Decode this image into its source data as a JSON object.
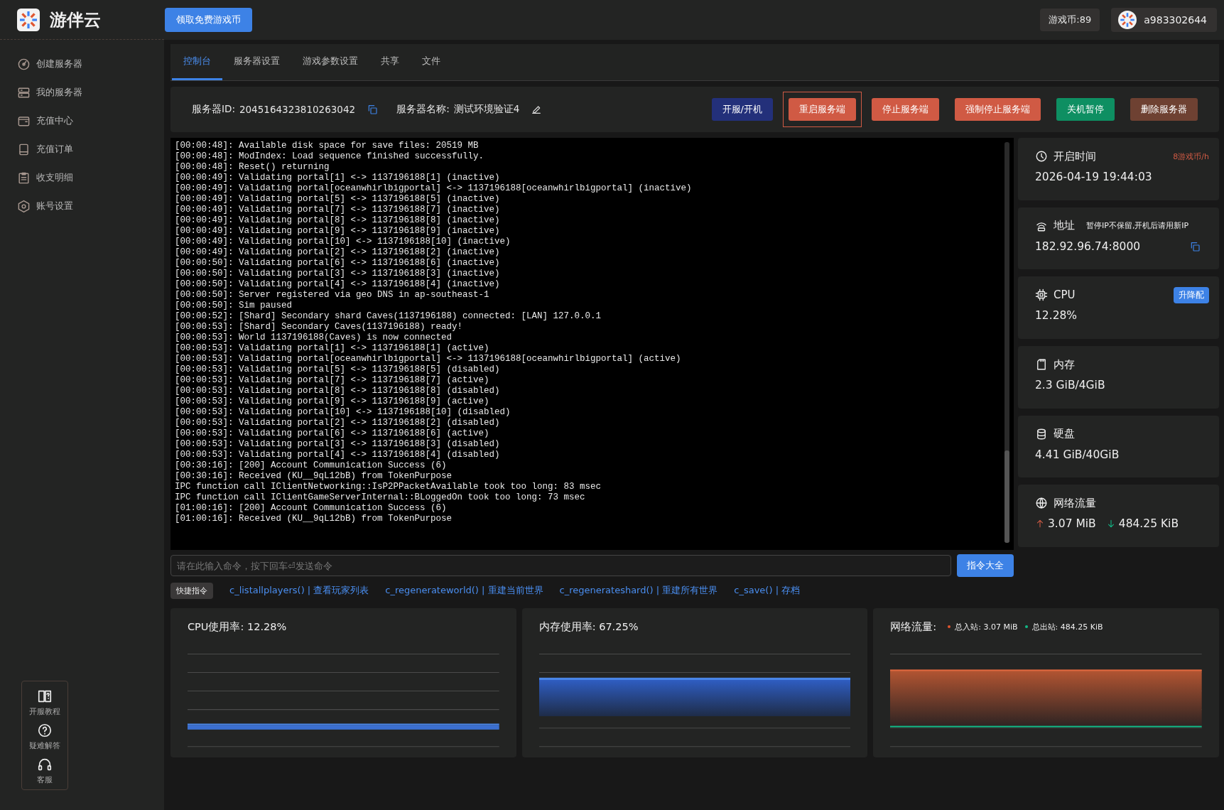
{
  "app": {
    "name": "游伴云",
    "promo_button": "领取免费游戏币",
    "coins": "游戏币:89",
    "user": "a983302644"
  },
  "sidebar": {
    "items": [
      {
        "label": "创建服务器"
      },
      {
        "label": "我的服务器"
      },
      {
        "label": "充值中心"
      },
      {
        "label": "充值订单"
      },
      {
        "label": "收支明细"
      },
      {
        "label": "账号设置"
      }
    ],
    "help": [
      {
        "label": "开服教程"
      },
      {
        "label": "疑难解答"
      },
      {
        "label": "客服"
      }
    ]
  },
  "tabs": [
    {
      "label": "控制台",
      "selected": true
    },
    {
      "label": "服务器设置",
      "selected": false
    },
    {
      "label": "游戏参数设置",
      "selected": false
    },
    {
      "label": "共享",
      "selected": false
    },
    {
      "label": "文件",
      "selected": false
    }
  ],
  "server": {
    "id_label": "服务器ID:",
    "id": "2045164323810263042",
    "name_label": "服务器名称:",
    "name": "测试环境验证4"
  },
  "actions": [
    {
      "label": "开服/开机",
      "color": "#23307a",
      "outlined": false
    },
    {
      "label": "重启服务端",
      "color": "#d05a44",
      "outlined": true
    },
    {
      "label": "停止服务端",
      "color": "#d05a44",
      "outlined": false
    },
    {
      "label": "强制停止服务端",
      "color": "#d05a44",
      "outlined": false
    },
    {
      "label": "关机暂停",
      "color": "#0e8f62",
      "outlined": false
    },
    {
      "label": "删除服务器",
      "color": "#6e4132",
      "outlined": false
    }
  ],
  "console": {
    "lines": [
      "[00:00:48]: Available disk space for save files: 20519 MB",
      "[00:00:48]: ModIndex: Load sequence finished successfully.",
      "[00:00:48]: Reset() returning",
      "[00:00:49]: Validating portal[1] <-> 1137196188[1] (inactive)",
      "[00:00:49]: Validating portal[oceanwhirlbigportal] <-> 1137196188[oceanwhirlbigportal] (inactive)",
      "[00:00:49]: Validating portal[5] <-> 1137196188[5] (inactive)",
      "[00:00:49]: Validating portal[7] <-> 1137196188[7] (inactive)",
      "[00:00:49]: Validating portal[8] <-> 1137196188[8] (inactive)",
      "[00:00:49]: Validating portal[9] <-> 1137196188[9] (inactive)",
      "[00:00:49]: Validating portal[10] <-> 1137196188[10] (inactive)",
      "[00:00:49]: Validating portal[2] <-> 1137196188[2] (inactive)",
      "[00:00:50]: Validating portal[6] <-> 1137196188[6] (inactive)",
      "[00:00:50]: Validating portal[3] <-> 1137196188[3] (inactive)",
      "[00:00:50]: Validating portal[4] <-> 1137196188[4] (inactive)",
      "[00:00:50]: Server registered via geo DNS in ap-southeast-1",
      "[00:00:50]: Sim paused",
      "[00:00:52]: [Shard] Secondary shard Caves(1137196188) connected: [LAN] 127.0.0.1",
      "[00:00:53]: [Shard] Secondary Caves(1137196188) ready!",
      "[00:00:53]: World 1137196188(Caves) is now connected",
      "[00:00:53]: Validating portal[1] <-> 1137196188[1] (active)",
      "[00:00:53]: Validating portal[oceanwhirlbigportal] <-> 1137196188[oceanwhirlbigportal] (active)",
      "[00:00:53]: Validating portal[5] <-> 1137196188[5] (disabled)",
      "[00:00:53]: Validating portal[7] <-> 1137196188[7] (active)",
      "[00:00:53]: Validating portal[8] <-> 1137196188[8] (disabled)",
      "[00:00:53]: Validating portal[9] <-> 1137196188[9] (active)",
      "[00:00:53]: Validating portal[10] <-> 1137196188[10] (disabled)",
      "[00:00:53]: Validating portal[2] <-> 1137196188[2] (disabled)",
      "[00:00:53]: Validating portal[6] <-> 1137196188[6] (active)",
      "[00:00:53]: Validating portal[3] <-> 1137196188[3] (disabled)",
      "[00:00:53]: Validating portal[4] <-> 1137196188[4] (disabled)",
      "[00:30:16]: [200] Account Communication Success (6)",
      "[00:30:16]: Received (KU__9qL12bB) from TokenPurpose",
      "IPC function call IClientNetworking::IsP2PPacketAvailable took too long: 83 msec",
      "IPC function call IClientGameServerInternal::BLoggedOn took too long: 73 msec",
      "[01:00:16]: [200] Account Communication Success (6)",
      "[01:00:16]: Received (KU__9qL12bB) from TokenPurpose"
    ]
  },
  "command": {
    "placeholder": "请在此输入命令，按下回车⏎发送命令",
    "button": "指令大全"
  },
  "quick": {
    "label": "快捷指令",
    "commands": [
      "c_listallplayers() | 查看玩家列表",
      "c_regenerateworld() | 重建当前世界",
      "c_regenerateshard() | 重建所有世界",
      "c_save() | 存档"
    ]
  },
  "stats": [
    {
      "kind": "time",
      "label": "开启时间",
      "note": "8游戏币/h",
      "value": "2026-04-19 19:44:03"
    },
    {
      "kind": "address",
      "label": "地址",
      "note": "暂停IP不保留,开机后请用新IP",
      "value": "182.92.96.74:8000"
    },
    {
      "kind": "cpu",
      "label": "CPU",
      "button": "升降配",
      "value": "12.28%"
    },
    {
      "kind": "memory",
      "label": "内存",
      "value": "2.3 GiB/4GiB"
    },
    {
      "kind": "disk",
      "label": "硬盘",
      "value": "4.41 GiB/40GiB"
    },
    {
      "kind": "network",
      "label": "网络流量",
      "up": "3.07 MiB",
      "down": "484.25 KiB"
    }
  ],
  "charts": [
    {
      "kind": "cpu",
      "title": "CPU使用率:  12.28%"
    },
    {
      "kind": "memory",
      "title": "内存使用率:  67.25%"
    },
    {
      "kind": "network",
      "title": "网络流量:",
      "legend": [
        {
          "label": "总入站: 3.07 MiB",
          "color": "#e0552f"
        },
        {
          "label": "总出站: 484.25 KiB",
          "color": "#12b886"
        }
      ]
    }
  ]
}
